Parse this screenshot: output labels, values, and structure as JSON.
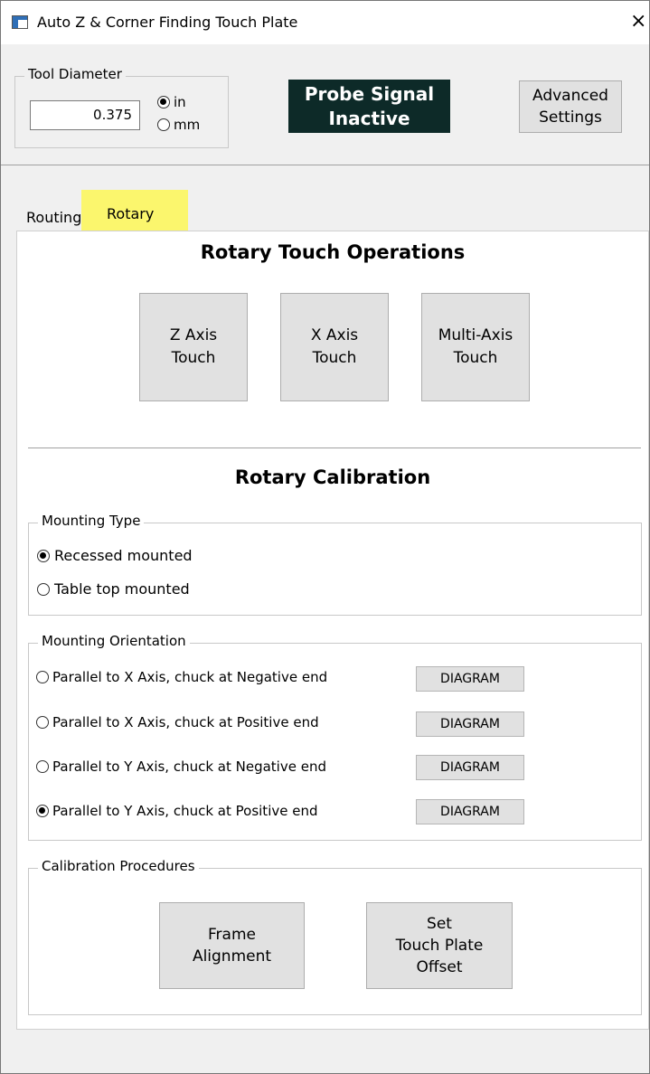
{
  "window": {
    "title": "Auto Z & Corner Finding Touch Plate",
    "close_glyph": "×"
  },
  "tool": {
    "legend": "Tool Diameter",
    "value": "0.375",
    "units": [
      {
        "label": "in",
        "selected": true
      },
      {
        "label": "mm",
        "selected": false
      }
    ]
  },
  "probe": {
    "status": "Probe Signal\nInactive",
    "bg_color": "#0d2a28"
  },
  "advanced_button": "Advanced\nSettings",
  "tabs": [
    {
      "label": "Routing",
      "active": false
    },
    {
      "label": "Rotary",
      "active": true,
      "highlight": "#fbf66d"
    }
  ],
  "rotary_touch": {
    "heading": "Rotary Touch Operations",
    "buttons": [
      "Z Axis\nTouch",
      "X Axis\nTouch",
      "Multi-Axis\nTouch"
    ]
  },
  "calibration": {
    "heading": "Rotary Calibration",
    "mounting_type": {
      "legend": "Mounting Type",
      "options": [
        {
          "label": "Recessed mounted",
          "selected": true
        },
        {
          "label": "Table top mounted",
          "selected": false
        }
      ]
    },
    "orientation": {
      "legend": "Mounting Orientation",
      "diagram_label": "DIAGRAM",
      "options": [
        {
          "label": "Parallel to X Axis, chuck at Negative end",
          "selected": false
        },
        {
          "label": "Parallel to X Axis, chuck at Positive end",
          "selected": false
        },
        {
          "label": "Parallel to Y Axis, chuck at Negative end",
          "selected": false
        },
        {
          "label": "Parallel to Y Axis, chuck at Positive end",
          "selected": true
        }
      ]
    },
    "procedures": {
      "legend": "Calibration Procedures",
      "buttons": [
        "Frame\nAlignment",
        "Set\nTouch Plate\nOffset"
      ]
    }
  }
}
